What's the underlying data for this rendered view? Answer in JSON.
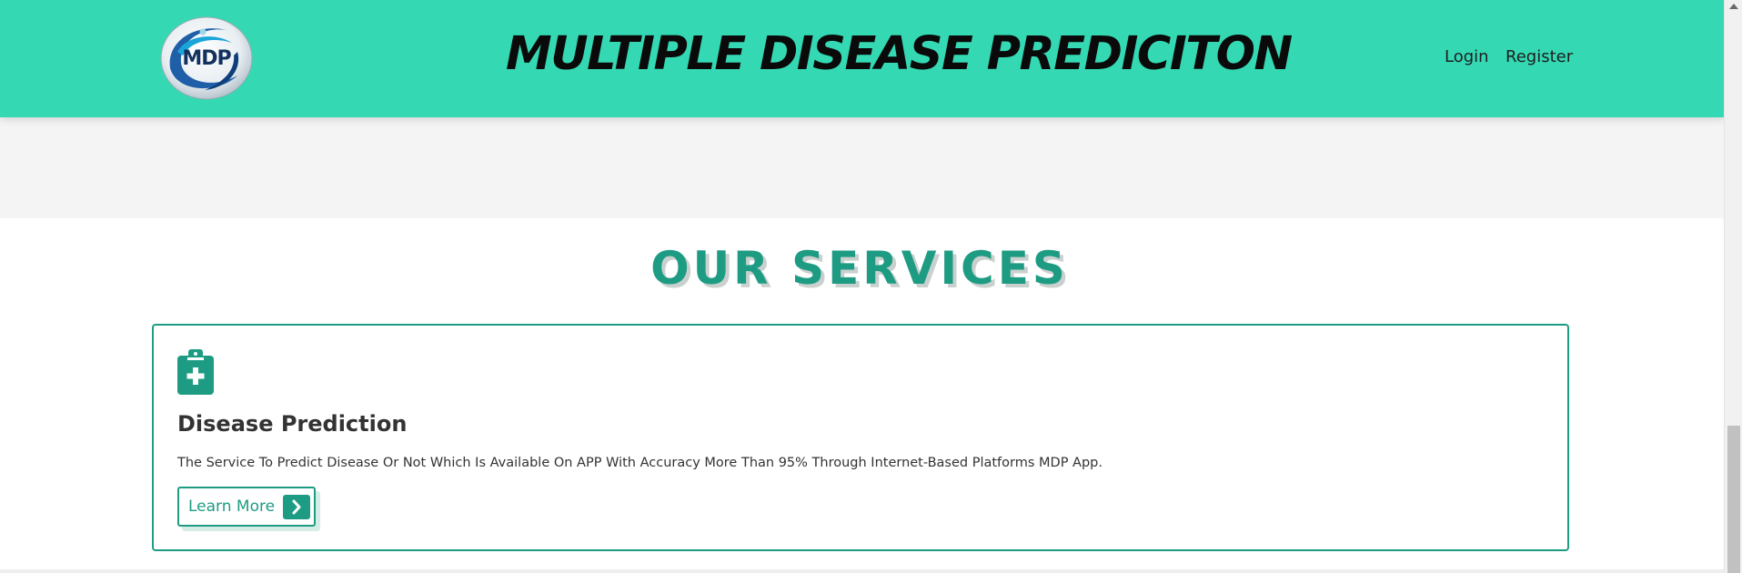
{
  "header": {
    "logo_text": "MDP",
    "title": "MULTIPLE DISEASE PREDICITON",
    "nav": {
      "login": "Login",
      "register": "Register"
    },
    "background": "#34d9b4"
  },
  "services": {
    "heading": "OUR SERVICES",
    "cards": [
      {
        "icon": "clipboard-medical-icon",
        "title": "Disease Prediction",
        "description": "The Service To Predict Disease Or Not Which Is Available On APP With Accuracy More Than 95% Through Internet-Based Platforms MDP App.",
        "button_label": "Learn More",
        "button_icon": "chevron-right-icon"
      }
    ]
  },
  "colors": {
    "accent": "#1e9c83",
    "header_bg": "#34d9b4",
    "band_bg": "#f4f4f4",
    "text_dark": "#333333"
  }
}
